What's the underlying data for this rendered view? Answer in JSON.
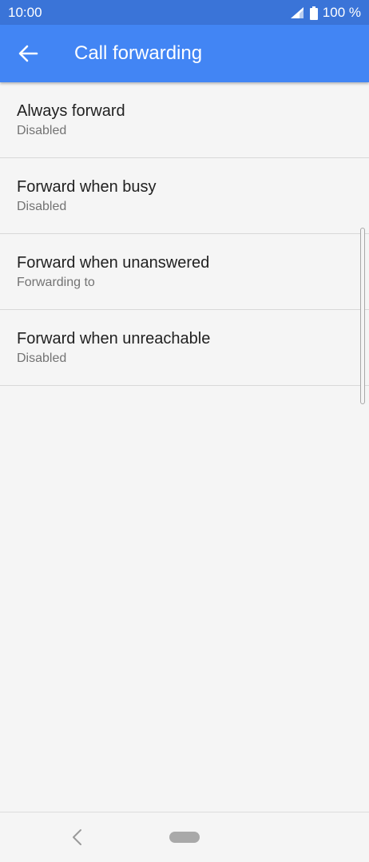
{
  "status_bar": {
    "time": "10:00",
    "battery": "100 %",
    "icons": [
      "signal-icon",
      "battery-icon"
    ]
  },
  "app_bar": {
    "title": "Call forwarding",
    "back_icon": "arrow-left-icon"
  },
  "items": [
    {
      "title": "Always forward",
      "subtitle": "Disabled"
    },
    {
      "title": "Forward when busy",
      "subtitle": "Disabled"
    },
    {
      "title": "Forward when unanswered",
      "subtitle": "Forwarding to"
    },
    {
      "title": "Forward when unreachable",
      "subtitle": "Disabled"
    }
  ],
  "nav_bar": {
    "icons": [
      "nav-back-icon",
      "home-pill-icon"
    ]
  },
  "colors": {
    "status_bar": "#3a74d8",
    "app_bar": "#4285f4",
    "background": "#f5f5f5"
  }
}
